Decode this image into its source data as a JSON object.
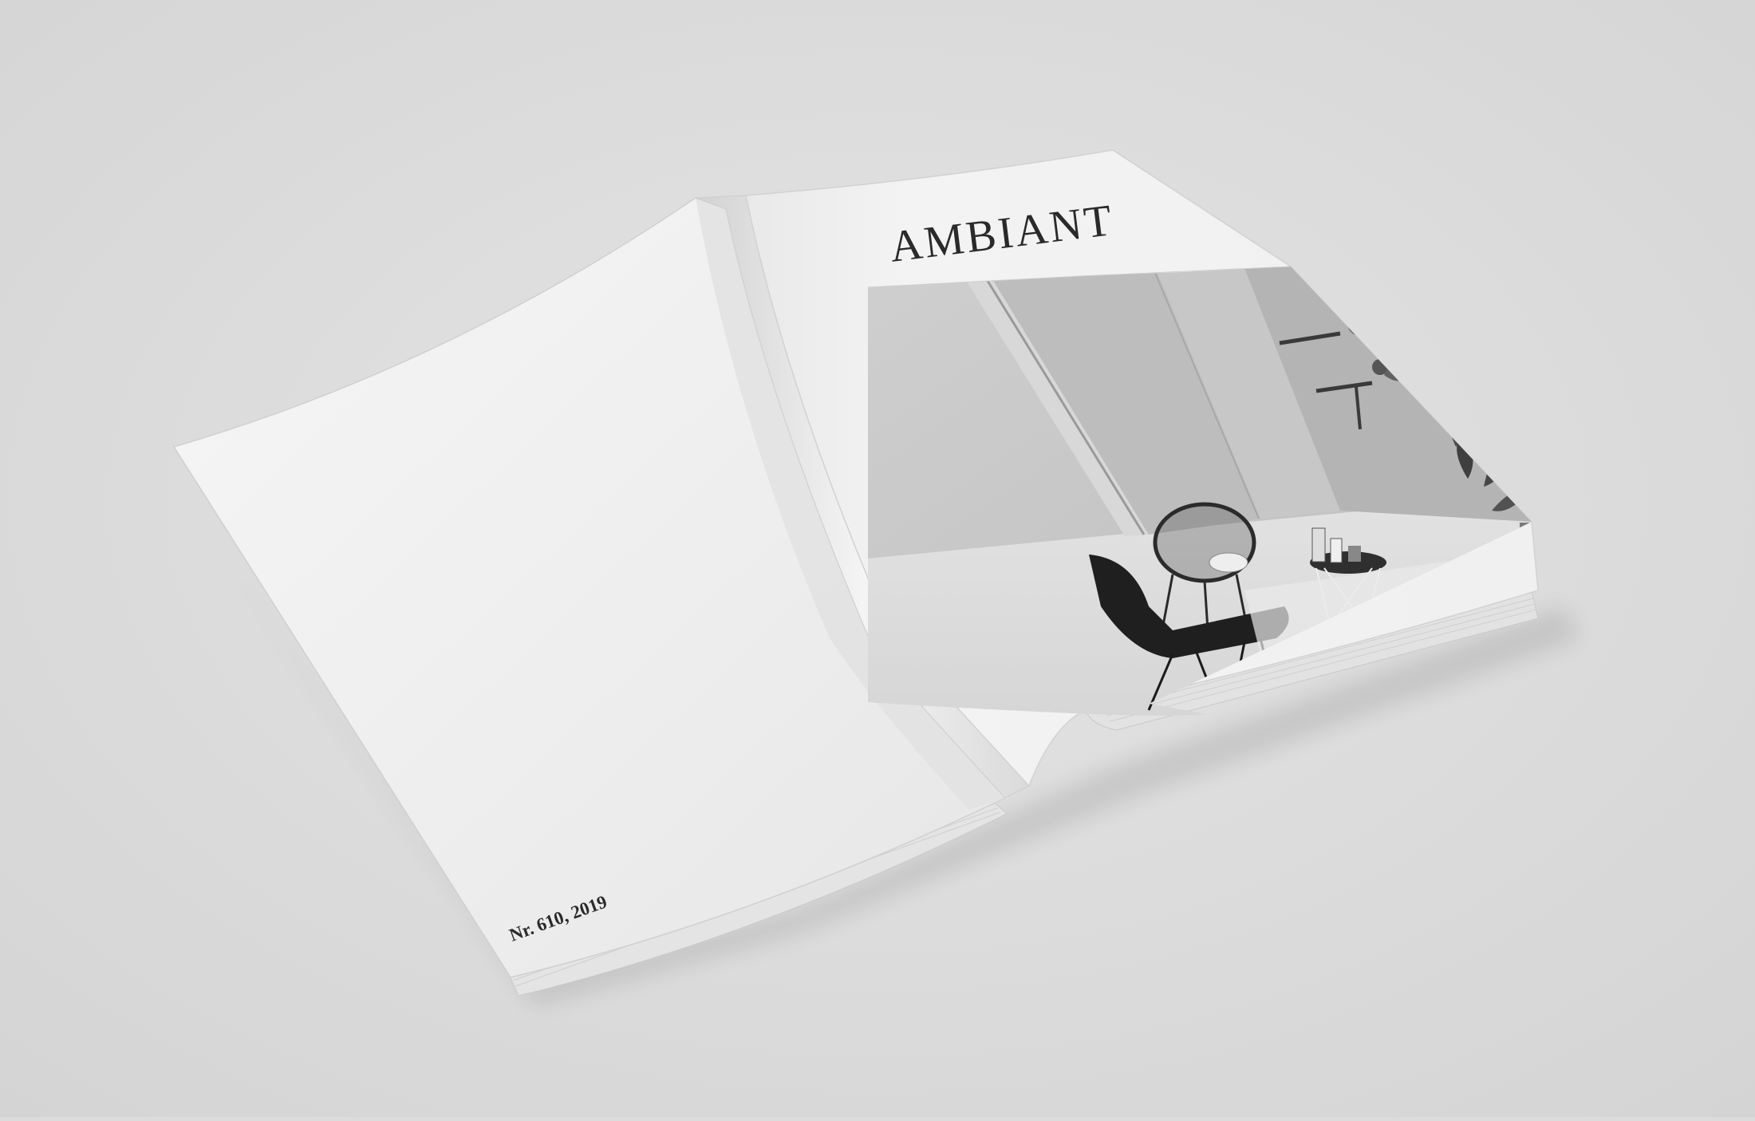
{
  "magazine": {
    "title": "AMBIANT",
    "issue_line": "Nr. 610, 2019"
  },
  "colors": {
    "background": "#dcdcdc",
    "paper": "#f1f1f1",
    "ink": "#2a2a2a"
  }
}
